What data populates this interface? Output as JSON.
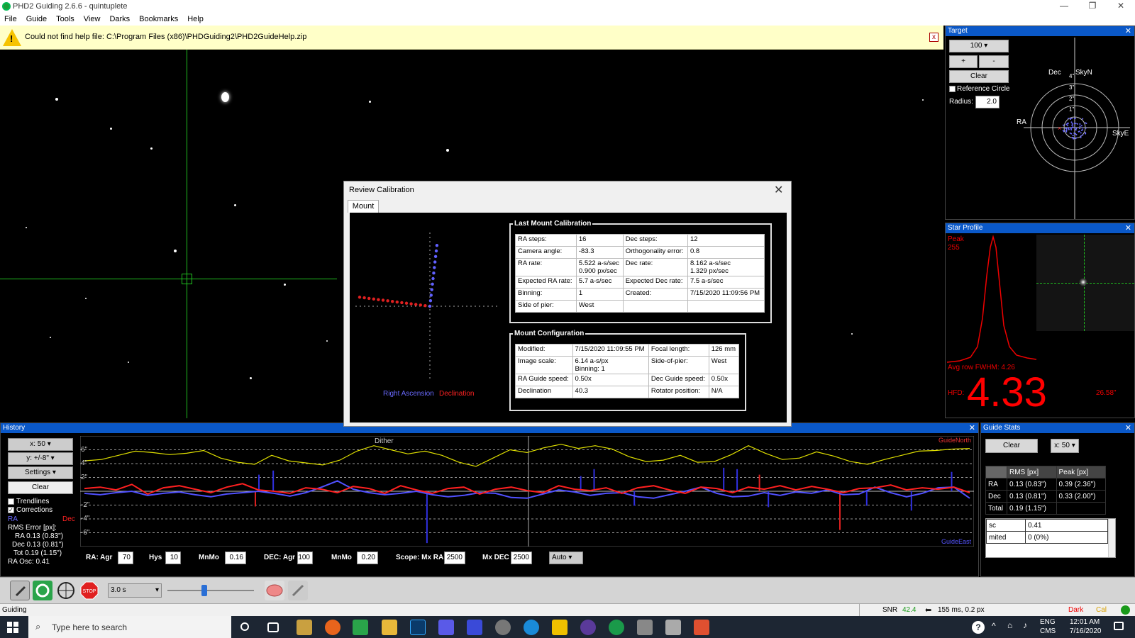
{
  "window": {
    "title": "PHD2 Guiding 2.6.6 - quintuplete",
    "minimize": "—",
    "restore": "❐",
    "close": "✕"
  },
  "menu": [
    "File",
    "Guide",
    "Tools",
    "View",
    "Darks",
    "Bookmarks",
    "Help"
  ],
  "infobar": {
    "message": "Could not find help file: C:\\Program Files (x86)\\PHDGuiding2\\PHD2GuideHelp.zip",
    "close": "x"
  },
  "target": {
    "title": "Target",
    "zoom": "100",
    "plus": "+",
    "minus": "-",
    "clear": "Clear",
    "reference_circle": "Reference Circle",
    "radius_label": "Radius:",
    "radius": "2.0",
    "labels": {
      "dec": "Dec",
      "skyn": "SkyN",
      "ra": "RA",
      "skye": "SkyE"
    },
    "ticks": [
      "4\"",
      "3\"",
      "2\"",
      "1\""
    ]
  },
  "star_profile": {
    "title": "Star Profile",
    "peak_label": "Peak",
    "peak": "255",
    "fwhm": "Avg row FWHM: 4.26",
    "hfd_label": "HFD:",
    "hfd": "4.33",
    "hfd_arcsec": "26.58\""
  },
  "dialog": {
    "title": "Review Calibration",
    "tab": "Mount",
    "legend_ra": "Right Ascension",
    "legend_dec": "Declination",
    "last_cal_title": "Last Mount Calibration",
    "last_cal": [
      [
        "RA steps:",
        "16",
        "Dec steps:",
        "12"
      ],
      [
        "Camera angle:",
        "-83.3",
        "Orthogonality error:",
        "0.8"
      ],
      [
        "RA rate:",
        "5.522 a-s/sec\n0.900 px/sec",
        "Dec rate:",
        "8.162 a-s/sec\n1.329 px/sec"
      ],
      [
        "Expected RA rate:",
        "5.7 a-s/sec",
        "Expected Dec rate:",
        "7.5 a-s/sec"
      ],
      [
        "Binning:",
        "1",
        "Created:",
        "7/15/2020 11:09:56 PM"
      ],
      [
        "Side of pier:",
        "West",
        "",
        ""
      ]
    ],
    "mount_cfg_title": "Mount Configuration",
    "mount_cfg": [
      [
        "Modified:",
        "7/15/2020 11:09:55 PM",
        "Focal length:",
        "126 mm"
      ],
      [
        "Image scale:",
        "6.14 a-s/px\nBinning: 1",
        "Side-of-pier:",
        "West"
      ],
      [
        "RA Guide speed:",
        "0.50x",
        "Dec Guide speed:",
        "0.50x"
      ],
      [
        "Declination",
        "40.3",
        "Rotator position:",
        "N/A"
      ]
    ]
  },
  "history": {
    "title": "History",
    "x_scale": "x: 50",
    "y_scale": "y: +/-8\"",
    "settings": "Settings",
    "clear": "Clear",
    "trendlines": "Trendlines",
    "corrections": "Corrections",
    "ra_label": "RA",
    "dec_label": "Dec",
    "rms_title": "RMS Error [px]:",
    "rms_ra": "RA 0.13 (0.83\")",
    "rms_dec": "Dec 0.13 (0.81\")",
    "rms_tot": "Tot 0.19 (1.15\")",
    "ra_osc": "RA Osc: 0.41",
    "y_ticks": [
      "6\"",
      "4\"",
      "2\"",
      "-2\"",
      "-4\"",
      "-6\""
    ],
    "dither": "Dither",
    "guide_north": "GuideNorth",
    "guide_east": "GuideEast",
    "controls": {
      "ra_agr_label": "RA: Agr",
      "ra_agr": "70",
      "hys_label": "Hys",
      "hys": "10",
      "mnmo_label": "MnMo",
      "mnmo": "0.16",
      "dec_agr_label": "DEC: Agr",
      "dec_agr": "100",
      "mnmo2_label": "MnMo",
      "mnmo2": "0.20",
      "scope_label": "Scope: Mx RA",
      "mx_ra": "2500",
      "mx_dec_label": "Mx DEC",
      "mx_dec": "2500",
      "mode": "Auto"
    }
  },
  "guide_stats": {
    "title": "Guide Stats",
    "clear": "Clear",
    "x_scale": "x: 50",
    "headers": [
      "",
      "RMS [px]",
      "Peak [px]"
    ],
    "rows": [
      [
        "RA",
        "0.13 (0.83\")",
        "0.39 (2.36\")"
      ],
      [
        "Dec",
        "0.13 (0.81\")",
        "0.33 (2.00\")"
      ],
      [
        "Total",
        "0.19 (1.15\")",
        ""
      ]
    ],
    "extra": [
      [
        "sc",
        "0.41"
      ],
      [
        "mited",
        "0 (0%)"
      ]
    ]
  },
  "toolbar": {
    "exposure": "3.0 s"
  },
  "status": {
    "state": "Guiding",
    "snr_label": "SNR",
    "snr": "42.4",
    "exposure": "155 ms, 0.2 px",
    "dark": "Dark",
    "cal": "Cal"
  },
  "taskbar": {
    "search": "Type here to search",
    "lang1": "ENG",
    "lang2": "CMS",
    "time": "12:01 AM",
    "date": "7/16/2020"
  },
  "chart_data": {
    "type": "line",
    "y_unit": "arcsec",
    "ylim": [
      -8,
      8
    ],
    "y_ticks": [
      "6\"",
      "4\"",
      "2\"",
      "-2\"",
      "-4\"",
      "-6\""
    ],
    "series": [
      {
        "name": "RA",
        "color": "#5050ff",
        "values": [
          -0.3,
          -0.5,
          -0.2,
          0,
          -0.6,
          -0.3,
          -0.1,
          -0.5,
          -0.8,
          -0.4,
          -0.2,
          0,
          -0.3,
          -0.7,
          -0.2,
          0.6,
          1.5,
          0.3,
          -0.2,
          -0.5,
          -0.3,
          0,
          -0.5,
          -0.8,
          -0.6,
          -0.2,
          -0.3,
          -0.9,
          -1,
          -0.4,
          0.2,
          -0.1,
          -0.6,
          -0.3,
          -0.2,
          -0.8,
          -1,
          -0.5,
          0,
          0.6,
          -0.3,
          -0.8,
          -0.7,
          -0.2,
          -0.6,
          -0.1,
          -0.3,
          0.2,
          -0.5,
          -0.4,
          0.6,
          -0.2,
          -0.8,
          -0.3,
          0.5,
          0.6,
          -1
        ]
      },
      {
        "name": "Dec",
        "color": "#ff2020",
        "values": [
          0.4,
          0.6,
          0.2,
          1,
          -0.4,
          0.5,
          0.8,
          0.3,
          -0.2,
          0.6,
          1.1,
          0.2,
          0,
          -0.3,
          0.5,
          0.3,
          -0.2,
          0.7,
          0.4,
          -0.3,
          0.8,
          0.2,
          -0.3,
          0.4,
          0.6,
          -0.4,
          0.3,
          0.6,
          0.1,
          -0.2,
          0.8,
          0.3,
          0.1,
          0.5,
          -0.3,
          0.5,
          0.8,
          0.2,
          -0.3,
          0.6,
          0.4,
          -0.2,
          0.6,
          0.3,
          0.8,
          0.2,
          0.7,
          0.3,
          -0.2,
          0.4,
          0.5,
          0.9,
          0.2,
          0.5,
          0.3,
          0.6,
          -0.2
        ]
      },
      {
        "name": "SNR",
        "color": "#e0e000",
        "values": [
          4.4,
          4.6,
          5.2,
          5.8,
          5.6,
          5.3,
          5.5,
          5.9,
          4.8,
          4.2,
          3.9,
          5.2,
          4.4,
          4.1,
          3.8,
          4.5,
          5.8,
          6.6,
          6,
          5.4,
          5.8,
          5.2,
          4.2,
          3.6,
          4.8,
          6,
          5.6,
          6.3,
          6.8,
          6.2,
          6.6,
          6.1,
          5,
          4.3,
          4.5,
          5.2,
          4.2,
          4.3,
          5.3,
          6.6,
          5.5,
          4.6,
          4.8,
          5.7,
          5.1,
          4.3,
          3.9,
          4.6,
          5.2,
          5.8,
          5.9,
          6.1,
          6.2
        ]
      }
    ]
  }
}
